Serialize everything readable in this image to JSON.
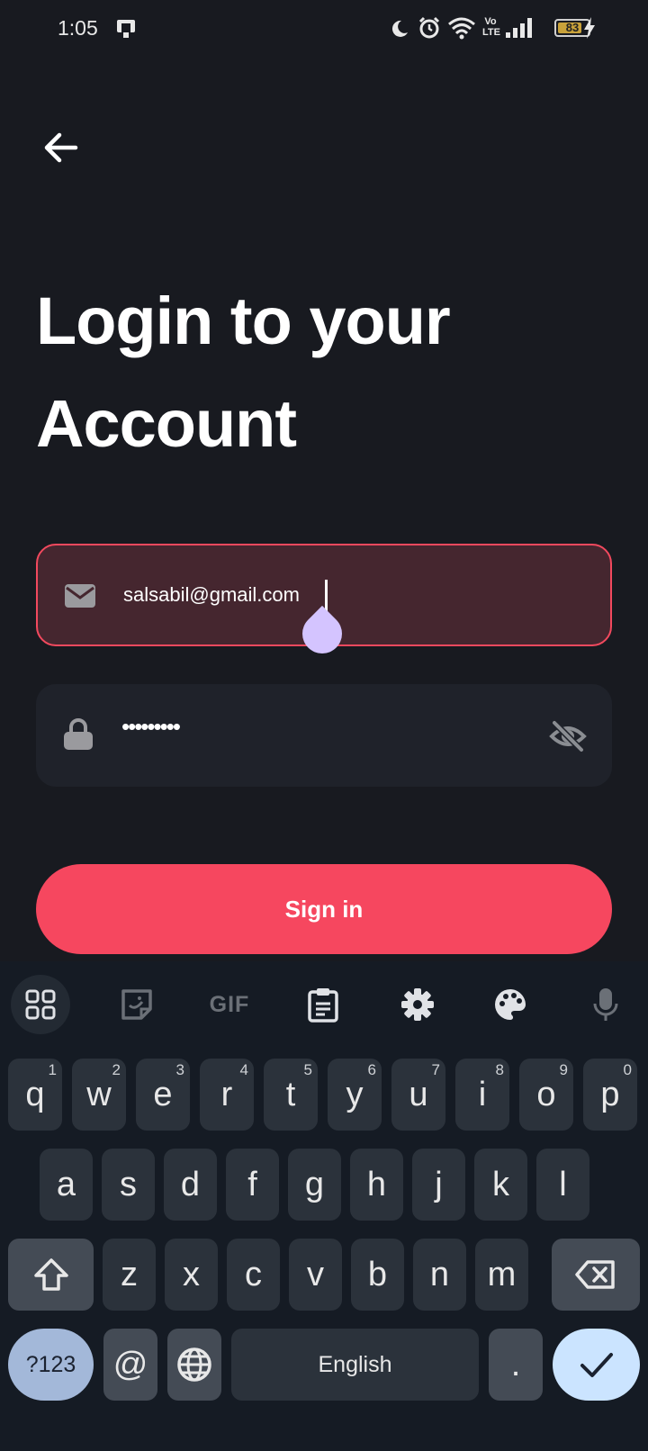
{
  "status_bar": {
    "time": "1:05",
    "battery": 83,
    "battery_label": "83",
    "icons": [
      "screen-cast-icon",
      "moon-icon",
      "alarm-icon",
      "wifi-icon",
      "volte-icon",
      "signal-icon",
      "battery-icon",
      "charging-icon"
    ],
    "volte_label": "Vo LTE"
  },
  "header": {
    "back_icon": "arrow-left-icon"
  },
  "page": {
    "title": "Login to your Account"
  },
  "form": {
    "email": {
      "value": "salsabil@gmail.com",
      "icon": "mail-icon"
    },
    "password": {
      "value": "•••••••••",
      "icon": "lock-icon",
      "toggle_icon": "eye-off-icon"
    },
    "submit_label": "Sign in"
  },
  "keyboard": {
    "toolbar": [
      "apps-grid-icon",
      "sticker-icon",
      "GIF",
      "clipboard-icon",
      "settings-gear-icon",
      "palette-icon",
      "microphone-icon"
    ],
    "gif_label": "GIF",
    "row1": [
      {
        "k": "q",
        "h": "1"
      },
      {
        "k": "w",
        "h": "2"
      },
      {
        "k": "e",
        "h": "3"
      },
      {
        "k": "r",
        "h": "4"
      },
      {
        "k": "t",
        "h": "5"
      },
      {
        "k": "y",
        "h": "6"
      },
      {
        "k": "u",
        "h": "7"
      },
      {
        "k": "i",
        "h": "8"
      },
      {
        "k": "o",
        "h": "9"
      },
      {
        "k": "p",
        "h": "0"
      }
    ],
    "row2": [
      "a",
      "s",
      "d",
      "f",
      "g",
      "h",
      "j",
      "k",
      "l"
    ],
    "row3": [
      "z",
      "x",
      "c",
      "v",
      "b",
      "n",
      "m"
    ],
    "symbols_label": "?123",
    "at_label": "@",
    "space_label": "English",
    "period_label": "."
  },
  "colors": {
    "background": "#181a20",
    "accent": "#f6475f",
    "field_active_bg": "#45262f",
    "field_bg": "#1f222a",
    "keyboard_bg": "#151b24",
    "key_bg": "#2b323b",
    "enter_key": "#cbe4ff",
    "symbols_key": "#a3b8d9"
  }
}
